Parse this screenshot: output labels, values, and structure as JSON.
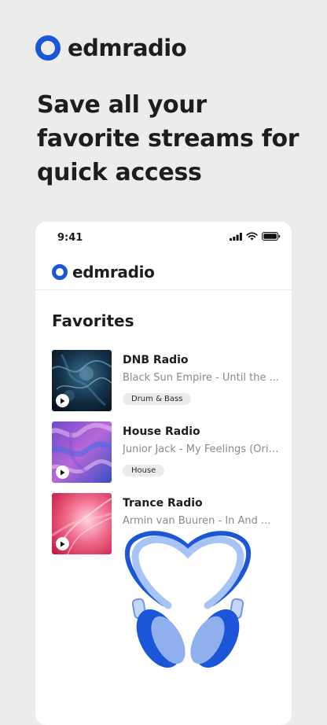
{
  "brand": {
    "name": "edmradio"
  },
  "headline": "Save all your favorite streams for quick access",
  "status_bar": {
    "time": "9:41"
  },
  "app": {
    "brand_name": "edmradio",
    "section_title": "Favorites",
    "favorites": [
      {
        "title": "DNB Radio",
        "track": "Black Sun Empire - Until the ...",
        "tag": "Drum & Bass"
      },
      {
        "title": "House Radio",
        "track": "Junior Jack - My Feelings (Orig...",
        "tag": "House"
      },
      {
        "title": "Trance Radio",
        "track": "Armin van Buuren - In And ..."
      }
    ]
  },
  "colors": {
    "brand": "#1b56d8",
    "background": "#ececec"
  }
}
